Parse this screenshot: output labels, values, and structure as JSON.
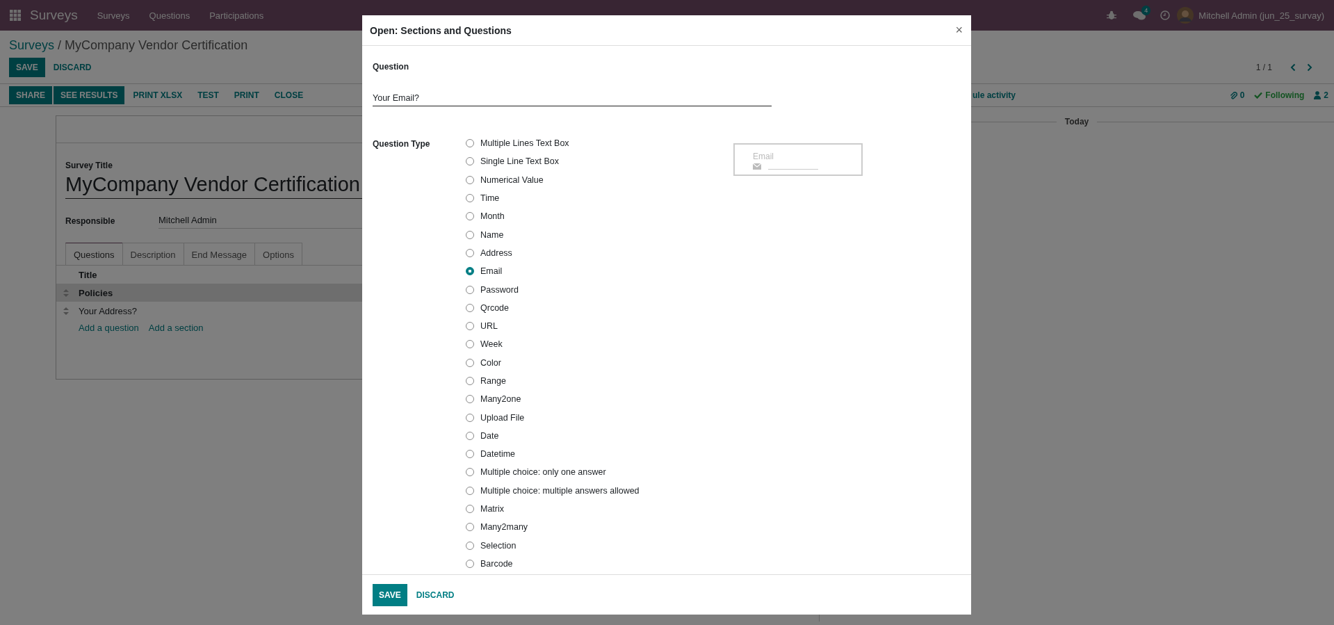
{
  "navbar": {
    "brand": "Surveys",
    "menu": [
      "Surveys",
      "Questions",
      "Participations"
    ],
    "message_count": "4",
    "user": "Mitchell Admin (jun_25_survay)"
  },
  "breadcrumb": {
    "parent": "Surveys",
    "separator": "/",
    "current": "MyCompany Vendor Certification"
  },
  "edit_buttons": [
    {
      "label": "SAVE",
      "kind": "primary"
    },
    {
      "label": "DISCARD",
      "kind": "link"
    }
  ],
  "pager": "1 / 1",
  "action_buttons": [
    {
      "label": "SHARE",
      "kind": "primary"
    },
    {
      "label": "SEE RESULTS",
      "kind": "primary"
    },
    {
      "label": "PRINT XLSX",
      "kind": "link"
    },
    {
      "label": "TEST",
      "kind": "link"
    },
    {
      "label": "PRINT",
      "kind": "link"
    },
    {
      "label": "CLOSE",
      "kind": "link"
    }
  ],
  "chatter": {
    "schedule": "ule activity",
    "attachments": "0",
    "follow": "Following",
    "followers": "2",
    "date_separator": "Today"
  },
  "form": {
    "title_label": "Survey Title",
    "title": "MyCompany Vendor Certification",
    "responsible_label": "Responsible",
    "responsible": "Mitchell Admin",
    "tabs": [
      {
        "label": "Questions",
        "selected": true
      },
      {
        "label": "Description",
        "selected": false
      },
      {
        "label": "End Message",
        "selected": false
      },
      {
        "label": "Options",
        "selected": false
      }
    ],
    "columns": [
      "Title"
    ],
    "rows": [
      {
        "title": "Policies",
        "kind": "section"
      },
      {
        "title": "Your Address?",
        "kind": "question"
      }
    ],
    "add_links": [
      "Add a question",
      "Add a section"
    ]
  },
  "dialog": {
    "title": "Open: Sections and Questions",
    "close": "×",
    "question_label": "Question",
    "question": "Your Email?",
    "type_label": "Question Type",
    "types": [
      {
        "label": "Multiple Lines Text Box",
        "selected": false
      },
      {
        "label": "Single Line Text Box",
        "selected": false
      },
      {
        "label": "Numerical Value",
        "selected": false
      },
      {
        "label": "Time",
        "selected": false
      },
      {
        "label": "Month",
        "selected": false
      },
      {
        "label": "Name",
        "selected": false
      },
      {
        "label": "Address",
        "selected": false
      },
      {
        "label": "Email",
        "selected": true
      },
      {
        "label": "Password",
        "selected": false
      },
      {
        "label": "Qrcode",
        "selected": false
      },
      {
        "label": "URL",
        "selected": false
      },
      {
        "label": "Week",
        "selected": false
      },
      {
        "label": "Color",
        "selected": false
      },
      {
        "label": "Range",
        "selected": false
      },
      {
        "label": "Many2one",
        "selected": false
      },
      {
        "label": "Upload File",
        "selected": false
      },
      {
        "label": "Date",
        "selected": false
      },
      {
        "label": "Datetime",
        "selected": false
      },
      {
        "label": "Multiple choice: only one answer",
        "selected": false
      },
      {
        "label": "Multiple choice: multiple answers allowed",
        "selected": false
      },
      {
        "label": "Matrix",
        "selected": false
      },
      {
        "label": "Many2many",
        "selected": false
      },
      {
        "label": "Selection",
        "selected": false
      },
      {
        "label": "Barcode",
        "selected": false
      }
    ],
    "preview": {
      "placeholder": "Email"
    },
    "buttons": [
      {
        "label": "SAVE",
        "kind": "primary"
      },
      {
        "label": "DISCARD",
        "kind": "link"
      }
    ]
  }
}
